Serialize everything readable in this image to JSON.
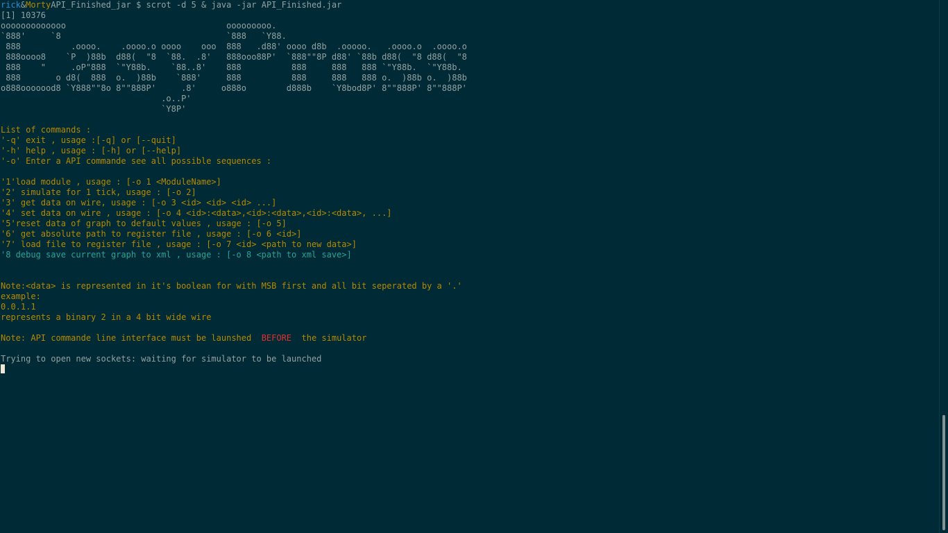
{
  "prompt": {
    "user": "rick",
    "separator": "&",
    "host": "Morty",
    "cwd": "API_Finished_jar $ ",
    "command": "scrot -d 5 & java -jar API_Finished.jar"
  },
  "job_line": "[1] 10376",
  "banner": [
    "ooooooooooooo                                ooooooooo.",
    "`888'     `8                                 `888   `Y88.",
    " 888          .oooo.    .oooo.o oooo    ooo  888   .d88' oooo d8b  .ooooo.   .oooo.o  .oooo.o",
    " 888oooo8    `P  )88b  d88(  \"8  `88.  .8'   888ooo88P'  `888\"\"8P d88' `88b d88(  \"8 d88(  \"8",
    " 888    \"     .oP\"888  `\"Y88b.    `88..8'    888          888     888   888 `\"Y88b.  `\"Y88b.",
    " 888       o d8(  888  o.  )88b    `888'     888          888     888   888 o.  )88b o.  )88b",
    "o888ooooood8 `Y888\"\"8o 8\"\"888P'     .8'     o888o        d888b    `Y8bod8P' 8\"\"888P' 8\"\"888P'",
    "                                .o..P'",
    "                                `Y8P'"
  ],
  "commands_header": "List of commands :",
  "commands": [
    "'-q' exit , usage :[-q] or [--quit]",
    "'-h' help , usage : [-h] or [--help]",
    "'-o' Enter a API commande see all possible sequences :"
  ],
  "sequences": [
    "'1'load module , usage : [-o 1 <ModuleName>]",
    "'2' simulate for 1 tick, usage : [-o 2]",
    "'3' get data on wire, usage : [-o 3 <id> <id> <id> ...]",
    "'4' set data on wire , usage : [-o 4 <id>:<data>,<id>:<data>,<id>:<data>, ...]",
    "'5'reset data of graph to default values , usage : [-o 5]",
    "'6' get absolute path to register file , usage : [-o 6 <id>]",
    "'7' load file to register file , usage : [-o 7 <id> <path to new data>]",
    "'8 debug save current graph to xml , usage : [-o 8 <path to xml save>]"
  ],
  "note_data": "Note:<data> is represented in it's boolean for with MSB first and all bit seperated by a '.'",
  "example_label": "example:",
  "example_value": "0.0.1.1",
  "example_desc": "represents a binary 2 in a 4 bit wide wire",
  "note_api": {
    "before": "Note: API commande line interface must be launshed  ",
    "highlight": "BEFORE",
    "after": "  the simulator"
  },
  "status": "Trying to open new sockets: waiting for simulator to be launched",
  "colors": {
    "background": "#002b36",
    "text": "#93a1a1",
    "yellow": "#b58900",
    "cyan": "#2aa198",
    "blue": "#268bd2",
    "red": "#dc322f"
  }
}
